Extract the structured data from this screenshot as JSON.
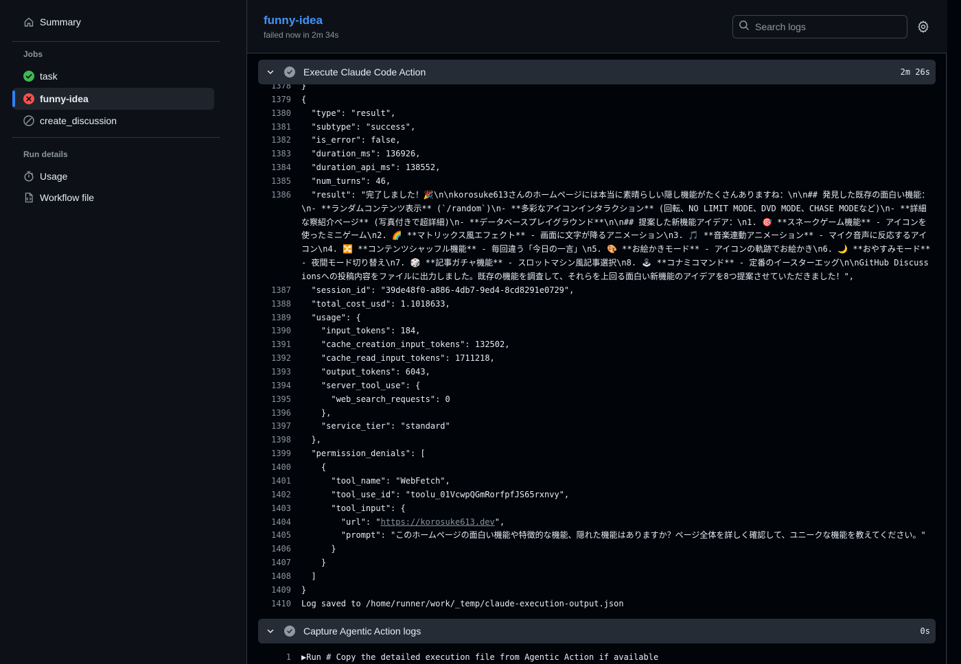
{
  "sidebar": {
    "summary": "Summary",
    "jobs_heading": "Jobs",
    "jobs": [
      {
        "label": "task",
        "status": "success"
      },
      {
        "label": "funny-idea",
        "status": "failed"
      },
      {
        "label": "create_discussion",
        "status": "skipped"
      }
    ],
    "run_details_heading": "Run details",
    "usage": "Usage",
    "workflow_file": "Workflow file"
  },
  "header": {
    "title": "funny-idea",
    "subtitle": "failed now in 2m 34s",
    "search_placeholder": "Search logs"
  },
  "steps": [
    {
      "name": "Execute Claude Code Action",
      "duration": "2m 26s"
    },
    {
      "name": "Capture Agentic Action logs",
      "duration": "0s"
    }
  ],
  "log1": [
    {
      "n": "1378",
      "t": "}"
    },
    {
      "n": "1379",
      "t": "{"
    },
    {
      "n": "1380",
      "t": "  \"type\": \"result\","
    },
    {
      "n": "1381",
      "t": "  \"subtype\": \"success\","
    },
    {
      "n": "1382",
      "t": "  \"is_error\": false,"
    },
    {
      "n": "1383",
      "t": "  \"duration_ms\": 136926,"
    },
    {
      "n": "1384",
      "t": "  \"duration_api_ms\": 138552,"
    },
    {
      "n": "1385",
      "t": "  \"num_turns\": 46,"
    },
    {
      "n": "1386",
      "t": "  \"result\": \"完了しました！🎉\\n\\nkorosuke613さんのホームページには本当に素晴らしい隠し機能がたくさんありますね：\\n\\n## 発見した既存の面白い機能：\\n- **ランダムコンテンツ表示** (`/random`)\\n- **多彩なアイコンインタラクション** (回転、NO LIMIT MODE、DVD MODE、CHASE MODEなど)\\n- **詳細な察紹介ページ** (写真付きで超詳細)\\n- **データベースプレイグラウンド**\\n\\n## 提案した新機能アイデア：\\n1. 🎯 **スネークゲーム機能** - アイコンを使ったミニゲーム\\n2. 🌈 **マトリックス風エフェクト** - 画面に文字が降るアニメーション\\n3. 🎵 **音楽連動アニメーション** - マイク音声に反応するアイコン\\n4. 🔀 **コンテンツシャッフル機能** - 毎回違う「今日の一言」\\n5. 🎨 **お絵かきモード** - アイコンの軌跡でお絵かき\\n6. 🌙 **おやすみモード** - 夜間モード切り替え\\n7. 🎲 **記事ガチャ機能** - スロットマシン風記事選択\\n8. 🕹 **コナミコマンド** - 定番のイースターエッグ\\n\\nGitHub Discussionsへの投稿内容をファイルに出力しました。既存の機能を調査して、それらを上回る面白い新機能のアイデアを8つ提案させていただきました！\","
    },
    {
      "n": "1387",
      "t": "  \"session_id\": \"39de48f0-a886-4db7-9ed4-8cd8291e0729\","
    },
    {
      "n": "1388",
      "t": "  \"total_cost_usd\": 1.1018633,"
    },
    {
      "n": "1389",
      "t": "  \"usage\": {"
    },
    {
      "n": "1390",
      "t": "    \"input_tokens\": 184,"
    },
    {
      "n": "1391",
      "t": "    \"cache_creation_input_tokens\": 132502,"
    },
    {
      "n": "1392",
      "t": "    \"cache_read_input_tokens\": 1711218,"
    },
    {
      "n": "1393",
      "t": "    \"output_tokens\": 6043,"
    },
    {
      "n": "1394",
      "t": "    \"server_tool_use\": {"
    },
    {
      "n": "1395",
      "t": "      \"web_search_requests\": 0"
    },
    {
      "n": "1396",
      "t": "    },"
    },
    {
      "n": "1397",
      "t": "    \"service_tier\": \"standard\""
    },
    {
      "n": "1398",
      "t": "  },"
    },
    {
      "n": "1399",
      "t": "  \"permission_denials\": ["
    },
    {
      "n": "1400",
      "t": "    {"
    },
    {
      "n": "1401",
      "t": "      \"tool_name\": \"WebFetch\","
    },
    {
      "n": "1402",
      "t": "      \"tool_use_id\": \"toolu_01VcwpQGmRorfpfJS65rxnvy\","
    },
    {
      "n": "1403",
      "t": "      \"tool_input\": {"
    },
    {
      "n": "1404",
      "t": "        \"url\": \"",
      "link": "https://korosuke613.dev",
      "after": "\","
    },
    {
      "n": "1405",
      "t": "        \"prompt\": \"このホームページの面白い機能や特徴的な機能、隠れた機能はありますか？ページ全体を詳しく確認して、ユニークな機能を教えてください。\""
    },
    {
      "n": "1406",
      "t": "      }"
    },
    {
      "n": "1407",
      "t": "    }"
    },
    {
      "n": "1408",
      "t": "  ]"
    },
    {
      "n": "1409",
      "t": "}"
    },
    {
      "n": "1410",
      "t": "Log saved to /home/runner/work/_temp/claude-execution-output.json"
    }
  ],
  "log2": [
    {
      "n": "1",
      "t": "▶Run # Copy the detailed execution file from Agentic Action if available"
    }
  ],
  "colors": {
    "accent": "#4493f8",
    "success": "#3fb950",
    "failed": "#f85149"
  }
}
